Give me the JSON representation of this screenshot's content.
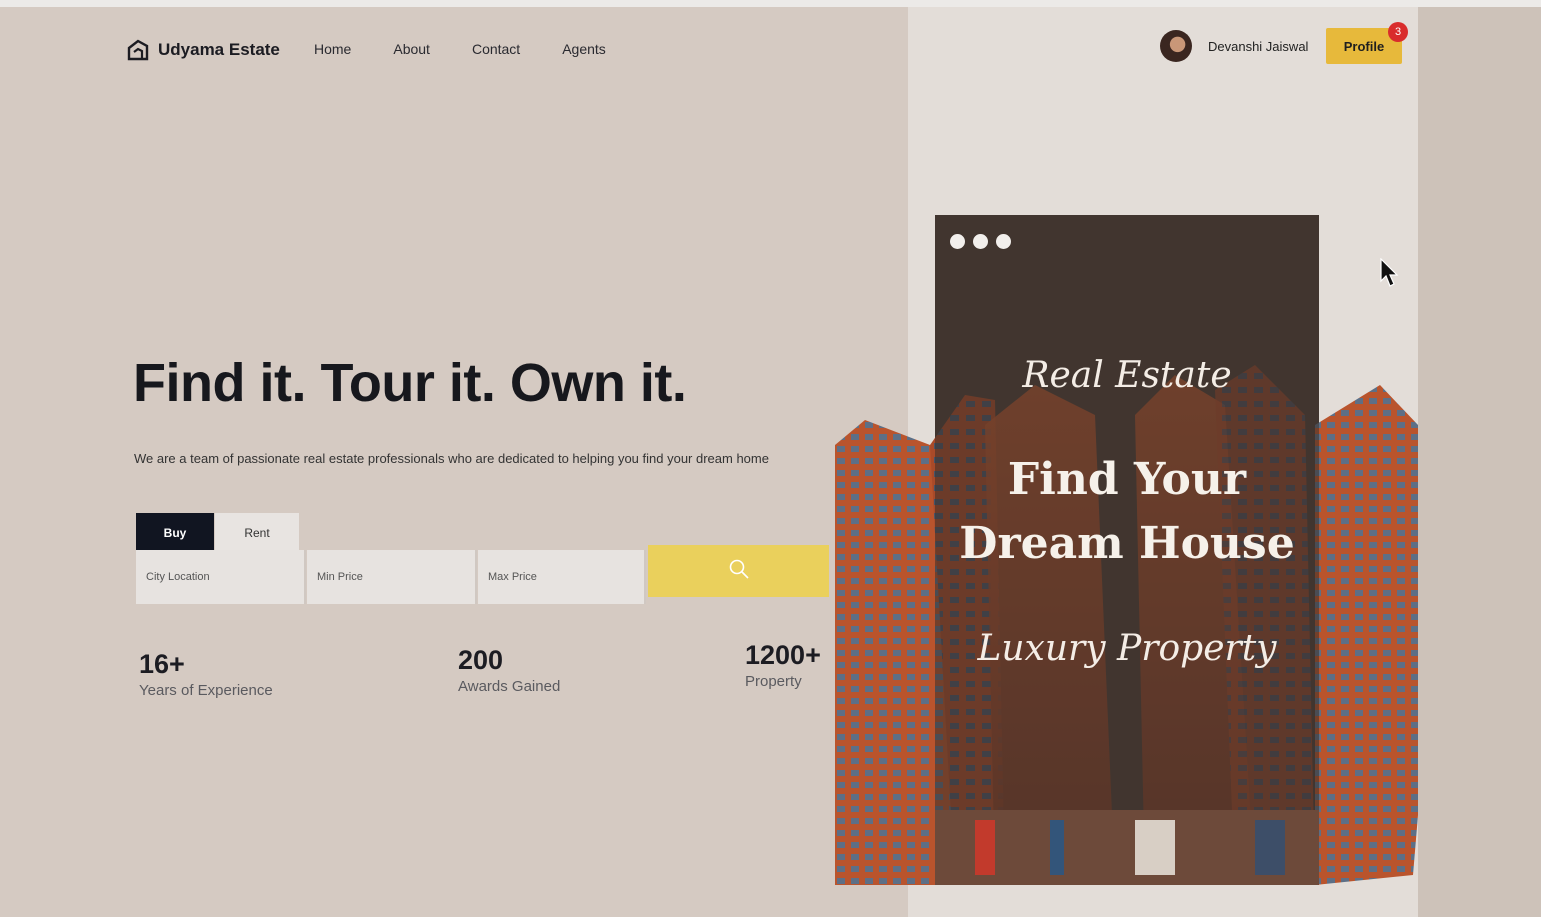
{
  "brand": {
    "name": "Udyama Estate"
  },
  "nav": {
    "items": [
      "Home",
      "About",
      "Contact",
      "Agents"
    ]
  },
  "user": {
    "name": "Devanshi Jaiswal",
    "profile_label": "Profile",
    "notification_count": "3"
  },
  "hero": {
    "headline": "Find it. Tour it. Own it.",
    "subtext": "We are a team of passionate real estate professionals who are dedicated to helping you find your dream home"
  },
  "search": {
    "tabs": [
      "Buy",
      "Rent"
    ],
    "active_tab": "Buy",
    "city_placeholder": "City Location",
    "min_price_placeholder": "Min Price",
    "max_price_placeholder": "Max Price"
  },
  "stats": [
    {
      "value": "16+",
      "label": "Years of Experience"
    },
    {
      "value": "200",
      "label": "Awards Gained"
    },
    {
      "value": "1200+",
      "label": "Property"
    }
  ],
  "poster": {
    "script_top": "Real Estate",
    "title_line1": "Find Your",
    "title_line2": "Dream House",
    "script_bottom": "Luxury Property"
  },
  "colors": {
    "accent": "#e7b93b",
    "dark": "#111521",
    "badge": "#d92c2c"
  }
}
